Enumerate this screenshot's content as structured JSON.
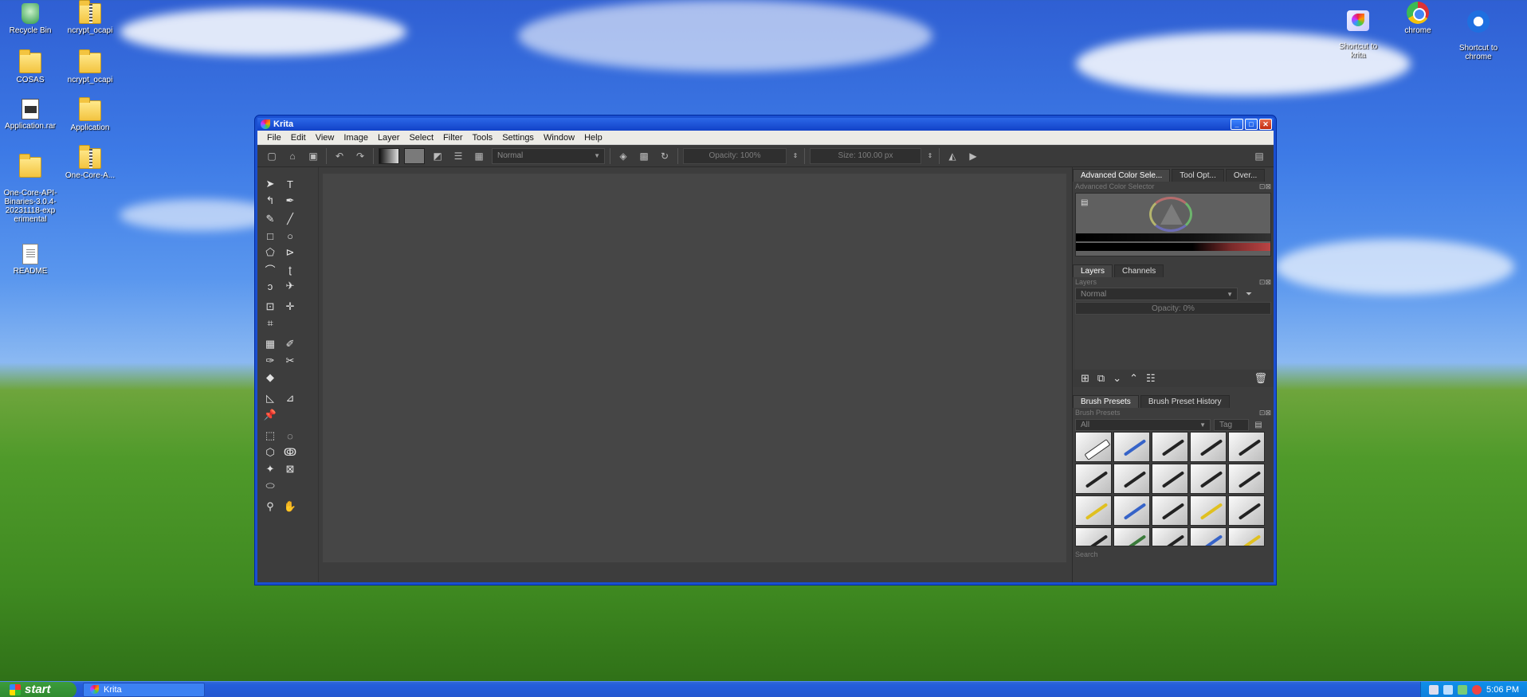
{
  "desktop": {
    "icons_left": [
      {
        "label": "Recycle Bin",
        "icon": "recycle-bin-icon"
      },
      {
        "label": "ncrypt_ocapi",
        "icon": "zip-folder-icon"
      },
      {
        "label": "COSAS",
        "icon": "folder-icon"
      },
      {
        "label": "ncrypt_ocapi",
        "icon": "folder-icon"
      },
      {
        "label": "Application.rar",
        "icon": "rar-archive-icon"
      },
      {
        "label": "Application",
        "icon": "folder-icon"
      },
      {
        "label": "One-Core-API-Binaries-3.0.4-20231118-experimental",
        "display": "One-Core-API-\nBinaries-3.0.4-\n20231118-exp\nerimental",
        "icon": "folder-icon"
      },
      {
        "label": "One-Core-A...",
        "icon": "zip-folder-icon"
      },
      {
        "label": "README",
        "icon": "text-document-icon"
      }
    ],
    "icons_right": [
      {
        "label": "Shortcut to krita",
        "display": "Shortcut to\nkrita",
        "icon": "krita-shortcut-icon"
      },
      {
        "label": "chrome",
        "icon": "chrome-icon"
      },
      {
        "label": "Shortcut to chrome",
        "display": "Shortcut to\nchrome",
        "icon": "chrome-shortcut-icon"
      }
    ]
  },
  "window": {
    "title": "Krita",
    "controls": {
      "minimize": "_",
      "maximize": "□",
      "close": "✕"
    }
  },
  "menubar": [
    "File",
    "Edit",
    "View",
    "Image",
    "Layer",
    "Select",
    "Filter",
    "Tools",
    "Settings",
    "Window",
    "Help"
  ],
  "toolbar": {
    "blend_mode": "Normal",
    "opacity": "Opacity:  100%",
    "size": "Size:  100.00 px"
  },
  "dock": {
    "color_tabs": [
      "Advanced Color Sele...",
      "Tool Opt...",
      "Over..."
    ],
    "color_panel_title": "Advanced Color Selector",
    "layers_tabs": [
      "Layers",
      "Channels"
    ],
    "layers_panel_title": "Layers",
    "layers_blend": "Normal",
    "layers_opacity": "Opacity:  0%",
    "brush_tabs": [
      "Brush Presets",
      "Brush Preset History"
    ],
    "brush_panel_title": "Brush Presets",
    "brush_filter": "All",
    "brush_tag": "Tag",
    "brush_search_placeholder": "Search"
  },
  "taskbar": {
    "start_label": "start",
    "task_items": [
      "Krita"
    ],
    "clock": "5:06 PM"
  },
  "colors": {
    "xp_blue": "#245edb",
    "krita_bg": "#3d3d3d",
    "canvas": "#464646",
    "start_green": "#2f8a2f"
  }
}
